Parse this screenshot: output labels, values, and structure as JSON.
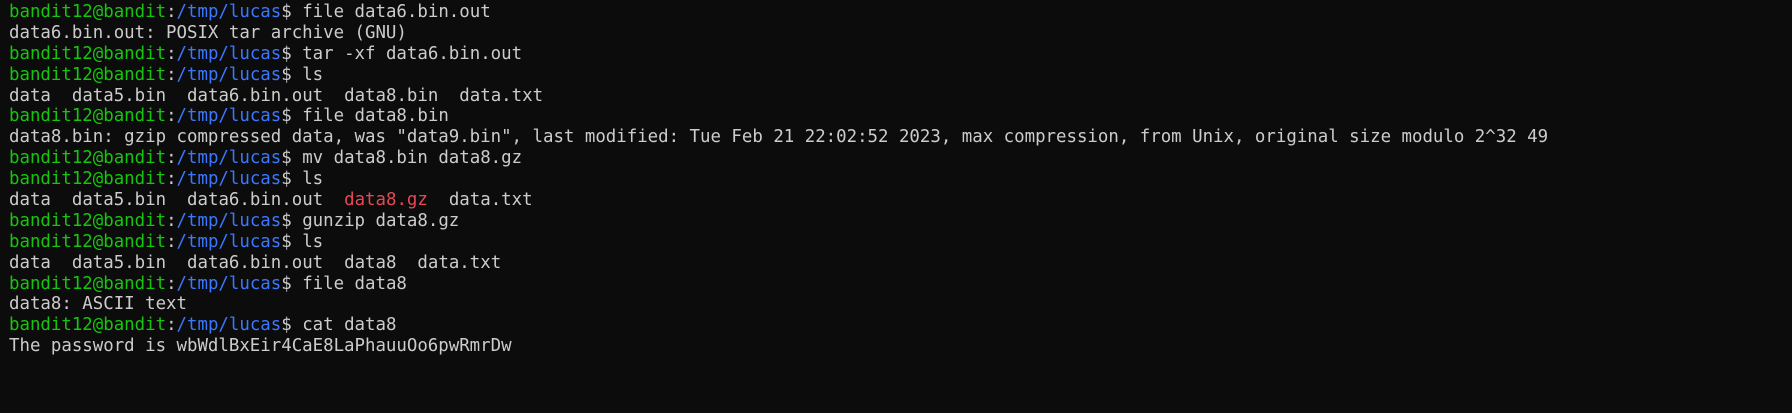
{
  "terminal": {
    "colors": {
      "background": "#0c0c0c",
      "text": "#cccccc",
      "user_host": "#16c60c",
      "path": "#3b78ff",
      "archive_file": "#e74856"
    },
    "prompt": {
      "user_host": "bandit12@bandit",
      "separator": ":",
      "path": "/tmp/lucas",
      "symbol": "$"
    },
    "lines": [
      {
        "type": "prompt",
        "command": " file data6.bin.out"
      },
      {
        "type": "output",
        "text": "data6.bin.out: POSIX tar archive (GNU)"
      },
      {
        "type": "prompt",
        "command": " tar -xf data6.bin.out"
      },
      {
        "type": "prompt",
        "command": " ls"
      },
      {
        "type": "ls",
        "items": [
          {
            "name": "data",
            "gap": "  "
          },
          {
            "name": "data5.bin",
            "gap": "  "
          },
          {
            "name": "data6.bin.out",
            "gap": "  "
          },
          {
            "name": "data8.bin",
            "gap": "  "
          },
          {
            "name": "data.txt",
            "gap": ""
          }
        ]
      },
      {
        "type": "prompt",
        "command": " file data8.bin"
      },
      {
        "type": "output",
        "text": "data8.bin: gzip compressed data, was \"data9.bin\", last modified: Tue Feb 21 22:02:52 2023, max compression, from Unix, original size modulo 2^32 49"
      },
      {
        "type": "prompt",
        "command": " mv data8.bin data8.gz"
      },
      {
        "type": "prompt",
        "command": " ls"
      },
      {
        "type": "ls",
        "items": [
          {
            "name": "data",
            "gap": "  "
          },
          {
            "name": "data5.bin",
            "gap": "  "
          },
          {
            "name": "data6.bin.out",
            "gap": "  "
          },
          {
            "name": "data8.gz",
            "gap": "  ",
            "archive": true
          },
          {
            "name": "data.txt",
            "gap": ""
          }
        ]
      },
      {
        "type": "prompt",
        "command": " gunzip data8.gz"
      },
      {
        "type": "prompt",
        "command": " ls"
      },
      {
        "type": "ls",
        "items": [
          {
            "name": "data",
            "gap": "  "
          },
          {
            "name": "data5.bin",
            "gap": "  "
          },
          {
            "name": "data6.bin.out",
            "gap": "  "
          },
          {
            "name": "data8",
            "gap": "  "
          },
          {
            "name": "data.txt",
            "gap": ""
          }
        ]
      },
      {
        "type": "prompt",
        "command": " file data8"
      },
      {
        "type": "output",
        "text": "data8: ASCII text"
      },
      {
        "type": "prompt",
        "command": " cat data8"
      },
      {
        "type": "output",
        "text": "The password is wbWdlBxEir4CaE8LaPhauuOo6pwRmrDw"
      }
    ]
  }
}
